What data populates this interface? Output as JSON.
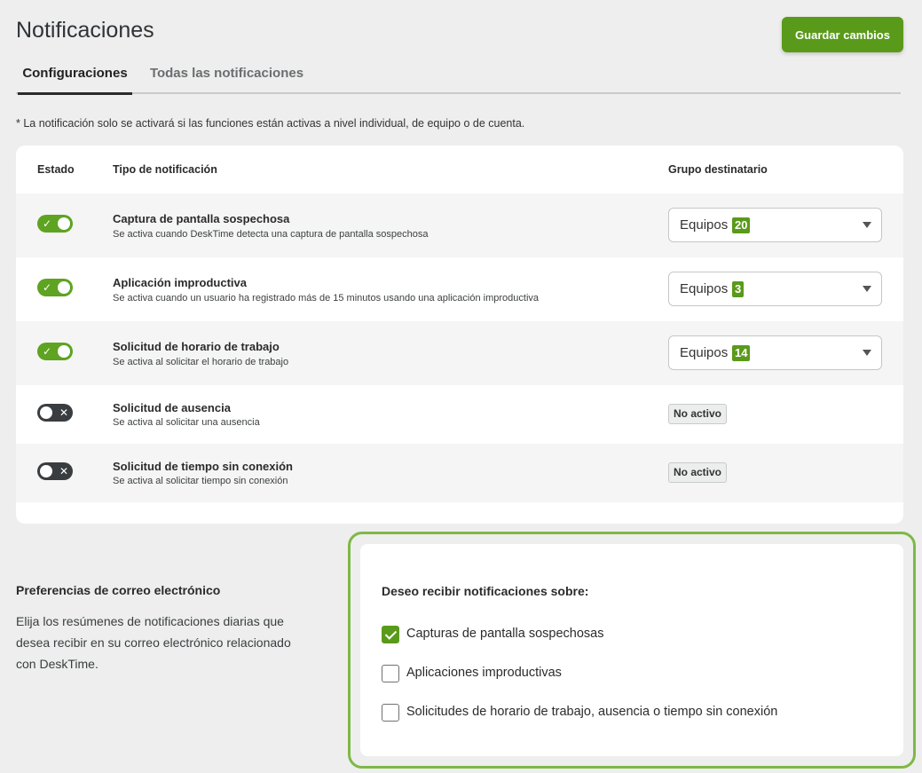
{
  "header": {
    "title": "Notificaciones",
    "save_label": "Guardar cambios"
  },
  "tabs": [
    {
      "label": "Configuraciones",
      "active": true
    },
    {
      "label": "Todas las notificaciones",
      "active": false
    }
  ],
  "note": "* La notificación solo se activará si las funciones están activas a nivel individual, de equipo o de cuenta.",
  "table": {
    "headers": {
      "status": "Estado",
      "type": "Tipo de notificación",
      "group": "Grupo destinatario"
    },
    "rows": [
      {
        "enabled": true,
        "title": "Captura de pantalla sospechosa",
        "desc": "Se activa cuando DeskTime detecta una captura de pantalla sospechosa",
        "group_label": "Equipos",
        "group_count": "20"
      },
      {
        "enabled": true,
        "title": "Aplicación improductiva",
        "desc": "Se activa cuando un usuario ha registrado más de 15 minutos usando una aplicación improductiva",
        "group_label": "Equipos",
        "group_count": "3"
      },
      {
        "enabled": true,
        "title": "Solicitud de horario de trabajo",
        "desc": "Se activa al solicitar el horario de trabajo",
        "group_label": "Equipos",
        "group_count": "14"
      },
      {
        "enabled": false,
        "title": "Solicitud de ausencia",
        "desc": "Se activa al solicitar una ausencia",
        "status_text": "No activo"
      },
      {
        "enabled": false,
        "title": "Solicitud de tiempo sin conexión",
        "desc": "Se activa al solicitar tiempo sin conexión",
        "status_text": "No activo"
      }
    ]
  },
  "email_prefs": {
    "title": "Preferencias de correo electrónico",
    "desc": "Elija los resúmenes de notificaciones diarias que desea recibir en su correo electrónico relacionado con DeskTime.",
    "heading": "Deseo recibir notificaciones sobre:",
    "options": [
      {
        "label": "Capturas de pantalla sospechosas",
        "checked": true
      },
      {
        "label": "Aplicaciones improductivas",
        "checked": false
      },
      {
        "label": "Solicitudes de horario de trabajo, ausencia o tiempo sin conexión",
        "checked": false
      }
    ]
  },
  "colors": {
    "accent": "#5a9a1a",
    "toggle_off": "#3a3d40",
    "highlight_border": "#7fb846",
    "background": "#edeeed"
  },
  "icons": {
    "toggle_on": "check-icon",
    "toggle_off": "x-icon",
    "dropdown": "caret-down-icon"
  }
}
